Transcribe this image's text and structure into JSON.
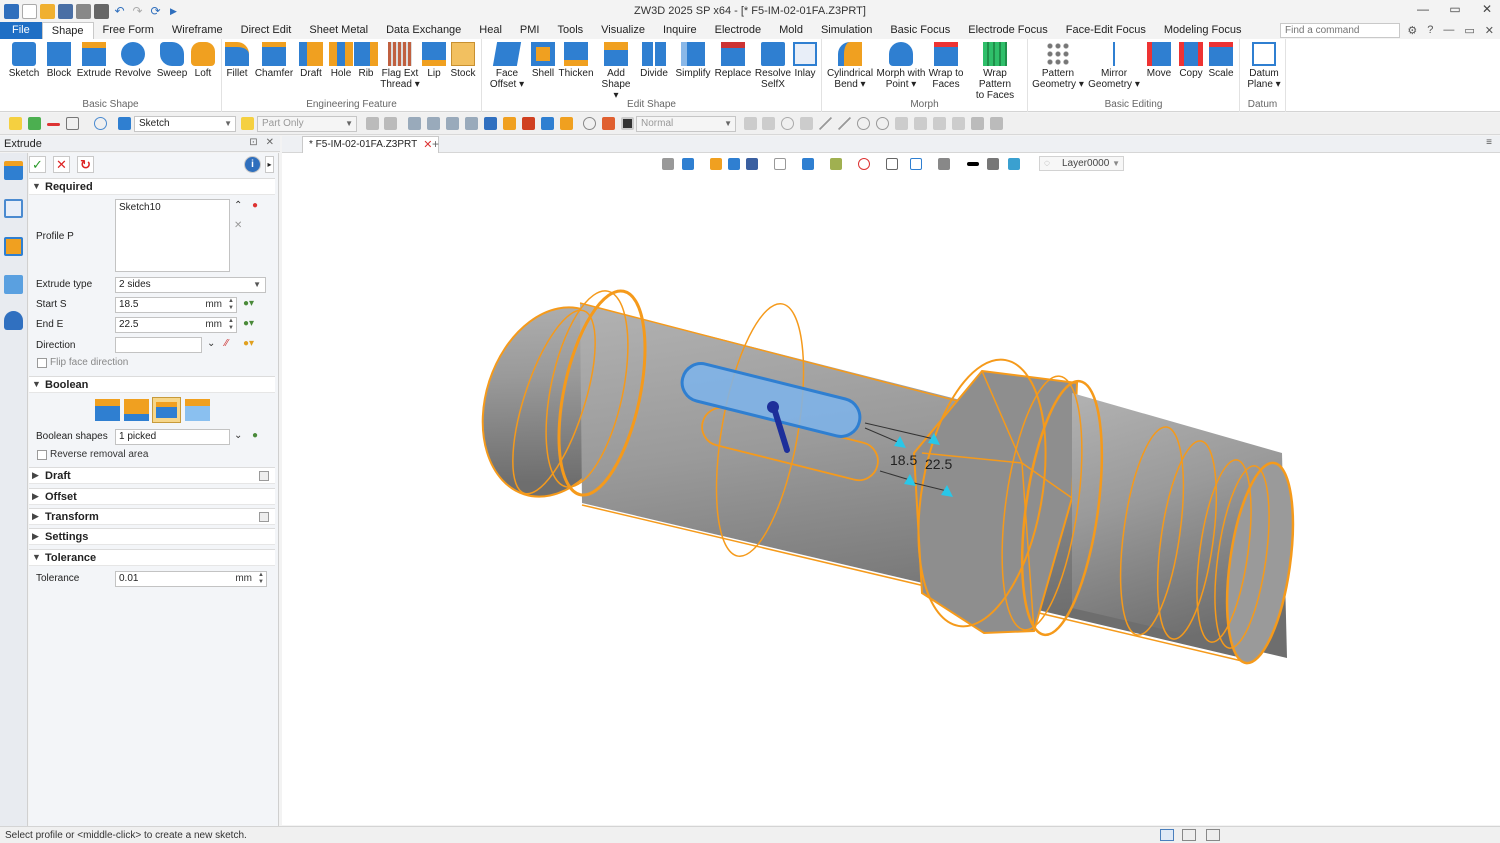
{
  "window": {
    "title": "ZW3D 2025 SP x64 - [* F5-IM-02-01FA.Z3PRT]",
    "controls": [
      "—",
      "▭",
      "✕"
    ]
  },
  "menu": {
    "file": "File",
    "items": [
      "Shape",
      "Free Form",
      "Wireframe",
      "Direct Edit",
      "Sheet Metal",
      "Data Exchange",
      "Heal",
      "PMI",
      "Tools",
      "Visualize",
      "Inquire",
      "Electrode",
      "Mold",
      "Simulation",
      "Basic Focus",
      "Electrode Focus",
      "Face-Edit Focus",
      "Modeling Focus"
    ],
    "active": "Shape",
    "find_placeholder": "Find a command",
    "right_controls": [
      "⚙",
      "?",
      "—",
      "▭",
      "✕"
    ]
  },
  "ribbon": {
    "groups": [
      {
        "title": "Basic Shape",
        "buttons": [
          [
            "Sketch",
            ""
          ],
          [
            "Block",
            ""
          ],
          [
            "Extrude",
            ""
          ],
          [
            "Revolve",
            ""
          ],
          [
            "Sweep",
            ""
          ],
          [
            "Loft",
            ""
          ]
        ]
      },
      {
        "title": "Engineering Feature",
        "buttons": [
          [
            "Fillet",
            ""
          ],
          [
            "Chamfer",
            ""
          ],
          [
            "Draft",
            ""
          ],
          [
            "Hole",
            ""
          ],
          [
            "Rib",
            ""
          ],
          [
            "Flag Ext",
            "Thread ▾"
          ],
          [
            "Lip",
            ""
          ],
          [
            "Stock",
            ""
          ]
        ]
      },
      {
        "title": "Edit Shape",
        "buttons": [
          [
            "Face",
            "Offset ▾"
          ],
          [
            "Shell",
            ""
          ],
          [
            "Thicken",
            ""
          ],
          [
            "Add",
            "Shape ▾"
          ],
          [
            "Divide",
            ""
          ],
          [
            "Simplify",
            ""
          ],
          [
            "Replace",
            ""
          ],
          [
            "Resolve",
            "SelfX"
          ],
          [
            "Inlay",
            ""
          ]
        ]
      },
      {
        "title": "Morph",
        "buttons": [
          [
            "Cylindrical",
            "Bend ▾"
          ],
          [
            "Morph with",
            "Point ▾"
          ],
          [
            "Wrap to",
            "Faces"
          ],
          [
            "Wrap Pattern",
            "to Faces"
          ]
        ]
      },
      {
        "title": "Basic Editing",
        "buttons": [
          [
            "Pattern",
            "Geometry ▾"
          ],
          [
            "Mirror",
            "Geometry ▾"
          ],
          [
            "Move",
            ""
          ],
          [
            "Copy",
            ""
          ],
          [
            "Scale",
            ""
          ]
        ]
      },
      {
        "title": "Datum",
        "buttons": [
          [
            "Datum",
            "Plane ▾"
          ]
        ]
      }
    ],
    "colors": {
      "blue": "#2f7fd1",
      "orange": "#f0a020",
      "accent": "#1f6fc5"
    }
  },
  "cmdbar": {
    "filter": "Sketch",
    "scope": "Part Only",
    "style": "Normal"
  },
  "panel": {
    "title": "Extrude",
    "required": {
      "header": "Required",
      "profile_label": "Profile P",
      "profile_value": "Sketch10",
      "extrude_type_label": "Extrude type",
      "extrude_type_value": "2 sides",
      "start_label": "Start S",
      "start_value": "18.5",
      "end_label": "End E",
      "end_value": "22.5",
      "unit": "mm",
      "direction_label": "Direction",
      "direction_value": "",
      "flip_label": "Flip face direction"
    },
    "boolean": {
      "header": "Boolean",
      "shapes_label": "Boolean shapes",
      "shapes_value": "1 picked",
      "reverse_label": "Reverse removal area"
    },
    "collapsed_sections": [
      "Draft",
      "Offset",
      "Transform",
      "Settings"
    ],
    "tolerance": {
      "header": "Tolerance",
      "label": "Tolerance",
      "value": "0.01",
      "unit": "mm"
    }
  },
  "viewport": {
    "tab": "* F5-IM-02-01FA.Z3PRT",
    "layer": "Layer0000",
    "dim_start": "18.5",
    "dim_end": "22.5",
    "colors": {
      "edges": "#f59a1b",
      "body": "#8f8f8f",
      "profile": "#4f93e0"
    }
  },
  "status": {
    "text": "Select profile or <middle-click> to create a new sketch."
  }
}
